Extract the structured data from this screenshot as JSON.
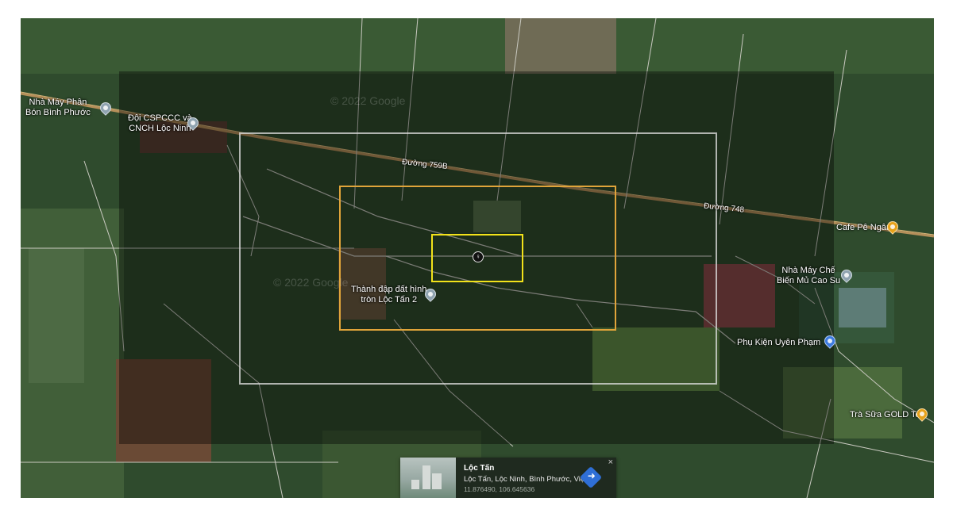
{
  "places": [
    {
      "name": "Nhà Máy Phân\nBón Bình Phước",
      "icon": "map-pin-icon",
      "color": "#8fa3b0"
    },
    {
      "name": "Đội CSPCCC và\nCNCH Lộc Ninh",
      "icon": "map-pin-icon",
      "color": "#8fa3b0"
    },
    {
      "name": "Thành đập đất hình\ntròn Lộc Tấn 2",
      "icon": "map-pin-icon",
      "color": "#8fa3b0"
    },
    {
      "name": "Cafe Pê Ngân",
      "icon": "cafe-icon",
      "color": "#e7a219"
    },
    {
      "name": "Nhà Máy Chế\nBiến Mủ Cao Su",
      "icon": "map-pin-icon",
      "color": "#8fa3b0"
    },
    {
      "name": "Phụ Kiện Uyên Phạm",
      "icon": "shopping-icon",
      "color": "#3c7be0"
    },
    {
      "name": "Trà Sữa GOLD Tea",
      "icon": "cafe-icon",
      "color": "#e7a219"
    }
  ],
  "roads": {
    "road_759b": "Đường 759B",
    "road_748": "Đường 748"
  },
  "watermarks": [
    "© 2022 Google",
    "© 2022 Google"
  ],
  "center_marker_glyph": "♀",
  "info_card": {
    "title": "Lộc Tấn",
    "address": "Lộc Tấn, Lộc Ninh, Bình Phước, Việ...",
    "coordinates": "11.876490, 106.645636",
    "close": "×",
    "directions_icon": "directions-icon"
  },
  "colors": {
    "white_frame": "#e1e1e1",
    "orange_frame": "#e0a43a",
    "yellow_frame": "#f2e21a"
  }
}
